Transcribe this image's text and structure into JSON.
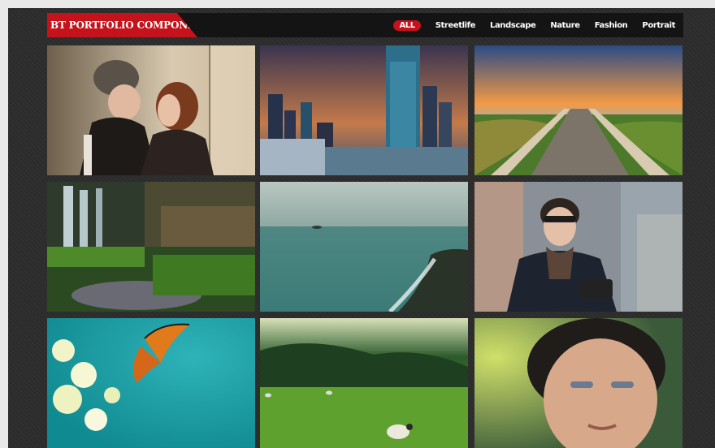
{
  "app": {
    "title": "BT PORTFOLIO COMPONENT"
  },
  "nav": {
    "items": [
      {
        "label": "ALL",
        "active": true
      },
      {
        "label": "Streetlife",
        "active": false
      },
      {
        "label": "Landscape",
        "active": false
      },
      {
        "label": "Nature",
        "active": false
      },
      {
        "label": "Fashion",
        "active": false
      },
      {
        "label": "Portrait",
        "active": false
      }
    ]
  },
  "gallery": {
    "tiles": [
      {
        "subject": "couple-photo"
      },
      {
        "subject": "city-skyline-photo"
      },
      {
        "subject": "beach-boardwalk-photo"
      },
      {
        "subject": "waterfall-photo"
      },
      {
        "subject": "ocean-coast-photo"
      },
      {
        "subject": "man-with-camera-photo"
      },
      {
        "subject": "butterfly-flowers-photo"
      },
      {
        "subject": "sheep-field-photo"
      },
      {
        "subject": "man-portrait-photo"
      }
    ]
  },
  "colors": {
    "accent": "#c5121b",
    "frame_bg": "#2b2b2b",
    "topbar_bg": "#141414"
  }
}
